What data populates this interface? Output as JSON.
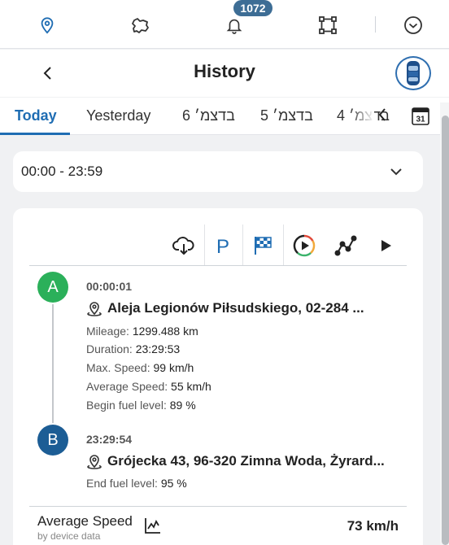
{
  "nav": {
    "notifications_badge": "1072",
    "icons": [
      "map-pin-icon",
      "map-icon",
      "bell-icon",
      "route-icon",
      "chevron-circle-icon"
    ]
  },
  "header": {
    "title": "History"
  },
  "tabs": {
    "items": [
      {
        "label": "Today",
        "active": true
      },
      {
        "label": "Yesterday"
      },
      {
        "label": "בדצמ׳ 6"
      },
      {
        "label": "בדצמ׳ 5"
      },
      {
        "label": "בדצמ׳ 4"
      }
    ],
    "calendar_day": "31"
  },
  "time_range": {
    "value": "00:00 - 23:59"
  },
  "trip": {
    "start": {
      "marker": "A",
      "time": "00:00:01",
      "address": "Aleja Legionów Piłsudskiego, 02-284 ...",
      "stats": [
        {
          "label": "Mileage:",
          "value": "1299.488 km"
        },
        {
          "label": "Duration:",
          "value": "23:29:53"
        },
        {
          "label": "Max. Speed:",
          "value": "99 km/h"
        },
        {
          "label": "Average Speed:",
          "value": "55 km/h"
        },
        {
          "label": "Begin fuel level:",
          "value": "89 %"
        }
      ]
    },
    "end": {
      "marker": "B",
      "time": "23:29:54",
      "address": "Grójecka 43, 96-320 Zimna Woda, Żyrard...",
      "stats": [
        {
          "label": "End fuel level:",
          "value": "95 %"
        }
      ]
    }
  },
  "average_speed": {
    "title": "Average Speed",
    "subtitle": "by device data",
    "value": "73 km/h"
  },
  "colors": {
    "accent": "#1f6db3",
    "marker_a": "#2bb05a",
    "marker_b": "#1c5d95",
    "badge": "#3d6d95"
  }
}
